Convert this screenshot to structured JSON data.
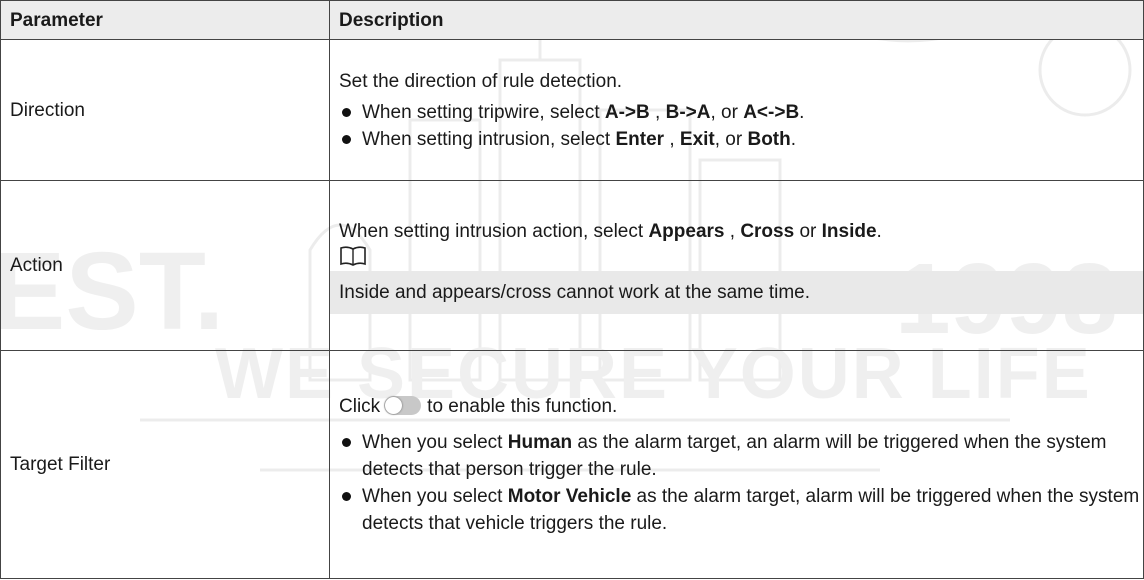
{
  "watermark": {
    "est": "EST.",
    "year": "1998",
    "slogan": "WE SECURE YOUR LIFE"
  },
  "table": {
    "headers": {
      "parameter": "Parameter",
      "description": "Description"
    },
    "rows": [
      {
        "parameter": "Direction",
        "intro": "Set the direction of rule detection.",
        "bullets": [
          {
            "pre": "When setting tripwire, select ",
            "k1": "A->B",
            "m1": " , ",
            "k2": "B->A",
            "m2": ", or ",
            "k3": "A<->B",
            "post": "."
          },
          {
            "pre": "When setting intrusion, select ",
            "k1": "Enter",
            "m1": " , ",
            "k2": "Exit",
            "m2": ", or ",
            "k3": "Both",
            "post": "."
          }
        ]
      },
      {
        "parameter": "Action",
        "intro": {
          "pre": "When setting intrusion action, select ",
          "k1": "Appears",
          "m1": " , ",
          "k2": "Cross",
          "m2": " or ",
          "k3": "Inside",
          "post": "."
        },
        "note_icon": "book-note-icon",
        "note": "Inside and appears/cross cannot work at the same time."
      },
      {
        "parameter": "Target Filter",
        "intro": {
          "pre": "Click",
          "post": "to enable this function."
        },
        "toggle_icon": "toggle-off-icon",
        "bullets": [
          {
            "pre": "When you select ",
            "k1": "Human",
            "post": "  as the alarm target, an alarm will be triggered when the system detects that person trigger the rule."
          },
          {
            "pre": "When you select ",
            "k1": "Motor Vehicle",
            "post": "  as the alarm target, alarm will be triggered when the system detects that vehicle triggers the rule."
          }
        ]
      }
    ]
  }
}
